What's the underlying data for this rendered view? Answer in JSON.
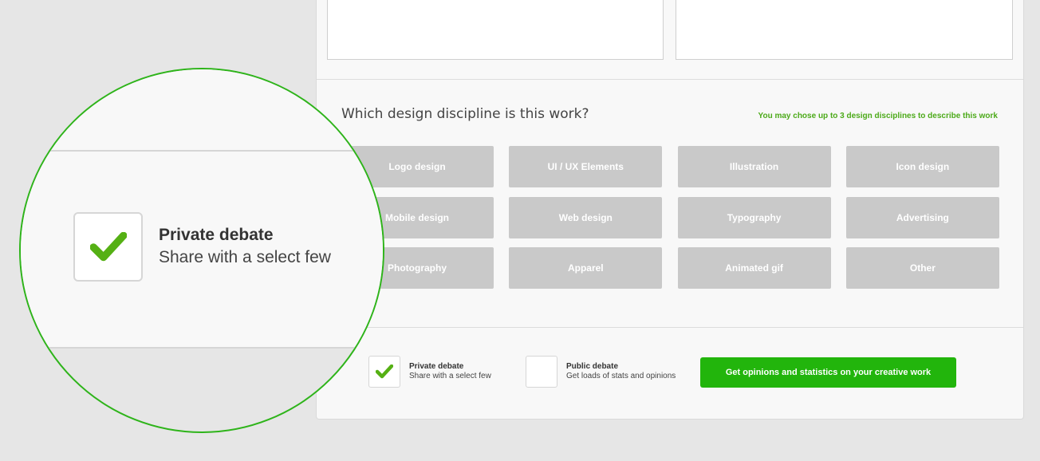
{
  "question": "Which design discipline is this work?",
  "hint": "You may chose up to 3 design disciplines to describe this work",
  "disciplines": [
    "Logo design",
    "UI / UX Elements",
    "Illustration",
    "Icon design",
    "Mobile design",
    "Web design",
    "Typography",
    "Advertising",
    "Photography",
    "Apparel",
    "Animated gif",
    "Other"
  ],
  "privacy": {
    "private": {
      "title": "Private debate",
      "subtitle": "Share with a select few",
      "checked": true
    },
    "public": {
      "title": "Public debate",
      "subtitle": "Get loads of stats and opinions",
      "checked": false
    }
  },
  "cta_label": "Get opinions and statistics on your creative work",
  "icons": {
    "check": "checkmark-icon"
  },
  "colors": {
    "accent": "#22b50c",
    "hint": "#4caa19",
    "tile": "#c9c9c9"
  }
}
